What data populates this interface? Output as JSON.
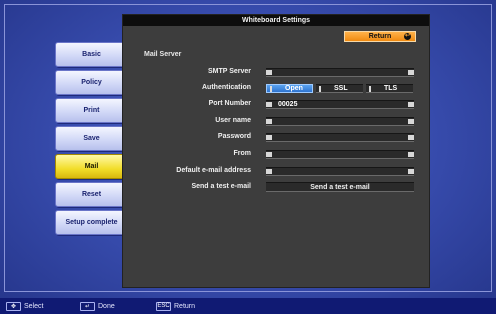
{
  "tabs": [
    "Basic",
    "Policy",
    "Print",
    "Save",
    "Mail",
    "Reset",
    "Setup complete"
  ],
  "active_tab": "Mail",
  "window": {
    "title": "Whiteboard Settings",
    "return_label": "Return"
  },
  "section_title": "Mail Server",
  "fields": {
    "smtp": {
      "label": "SMTP Server",
      "value": ""
    },
    "auth": {
      "label": "Authentication",
      "options": [
        "Open",
        "SSL",
        "TLS"
      ],
      "selected": "Open"
    },
    "port": {
      "label": "Port Number",
      "value": "00025"
    },
    "user": {
      "label": "User name",
      "value": ""
    },
    "password": {
      "label": "Password",
      "value": ""
    },
    "from": {
      "label": "From",
      "value": ""
    },
    "default_email": {
      "label": "Default e-mail address",
      "value": ""
    },
    "test": {
      "label": "Send a test e-mail",
      "button": "Send a test e-mail"
    }
  },
  "status_bar": {
    "select": "Select",
    "done": "Done",
    "return": "Return",
    "esc_key": "ESC"
  },
  "colors": {
    "accent_orange": "#f08a10",
    "active_tab": "#f2de2a",
    "selected_option": "#2f74d0"
  }
}
